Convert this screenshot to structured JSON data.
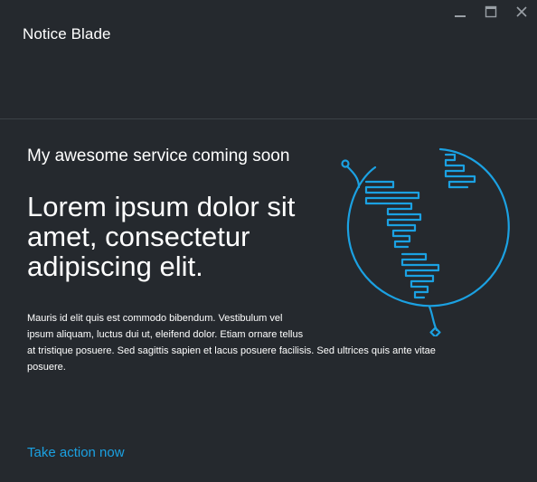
{
  "window": {
    "title": "Notice Blade",
    "controls": {
      "minimize_icon": "minimize-icon",
      "maximize_icon": "maximize-icon",
      "close_icon": "close-icon"
    }
  },
  "main": {
    "subtitle": "My awesome service coming soon",
    "headline": "Lorem ipsum dolor sit amet, consectetur adipiscing elit.",
    "body_lines": [
      "Mauris id elit quis est commodo bibendum. Vestibulum vel",
      "ipsum aliquam, luctus dui ut, eleifend dolor. Etiam ornare tellus",
      "at tristique posuere. Sed sagittis sapien et lacus posuere facilisis. Sed ultrices quis ante vitae",
      "posuere."
    ],
    "action_label": "Take action now",
    "illustration_icon": "globe-icon"
  },
  "colors": {
    "background": "#25292e",
    "accent": "#1ba1e2",
    "text": "#ffffff",
    "divider": "#3c4147"
  }
}
